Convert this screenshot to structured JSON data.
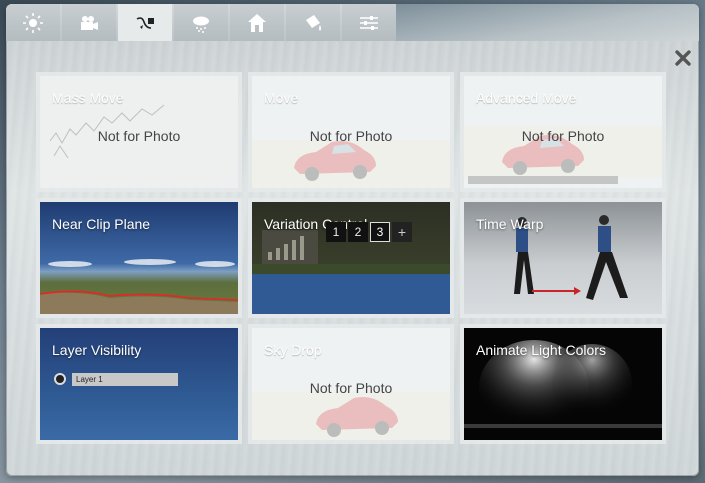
{
  "toolbar": {
    "tabs": [
      {
        "icon": "sun-icon",
        "active": false
      },
      {
        "icon": "video-camera-icon",
        "active": false
      },
      {
        "icon": "object-move-icon",
        "active": true
      },
      {
        "icon": "weather-cloud-icon",
        "active": false
      },
      {
        "icon": "house-icon",
        "active": false
      },
      {
        "icon": "paint-bucket-icon",
        "active": false
      },
      {
        "icon": "sliders-icon",
        "active": false
      }
    ]
  },
  "close_button": {
    "icon": "close-icon"
  },
  "effects": [
    {
      "title": "Mass Move",
      "note": "Not for Photo",
      "enabled": false
    },
    {
      "title": "Move",
      "note": "Not for Photo",
      "enabled": false
    },
    {
      "title": "Advanced Move",
      "note": "Not for Photo",
      "enabled": false
    },
    {
      "title": "Near Clip Plane",
      "enabled": true
    },
    {
      "title": "Variation Control",
      "enabled": true,
      "variations": [
        "1",
        "2",
        "3",
        "+"
      ],
      "selected": "3"
    },
    {
      "title": "Time Warp",
      "enabled": true
    },
    {
      "title": "Layer Visibility",
      "enabled": true,
      "layer_label": "Layer 1"
    },
    {
      "title": "Sky Drop",
      "note": "Not for Photo",
      "enabled": false
    },
    {
      "title": "Animate Light Colors",
      "enabled": true
    }
  ],
  "colors": {
    "accent_red": "#c8252a",
    "panel": "#dfe4e5",
    "sky_blue": "#2f5a93"
  }
}
